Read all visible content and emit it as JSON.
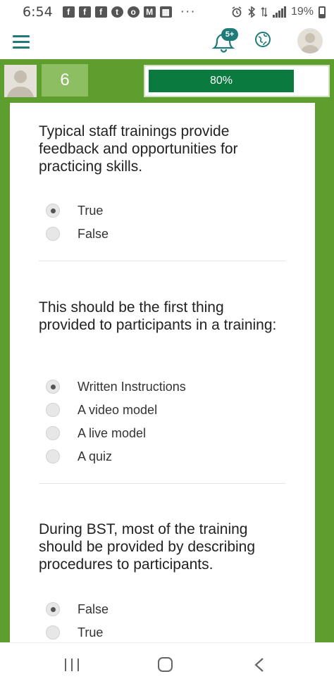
{
  "status_bar": {
    "time": "6:54",
    "app_icons": [
      "facebook-icon",
      "facebook-icon",
      "facebook-icon",
      "twitter-icon",
      "opera-icon",
      "gmail-icon",
      "photo-icon"
    ],
    "app_glyphs": [
      "f",
      "f",
      "f",
      "t",
      "o",
      "M",
      "▦"
    ],
    "more": "···",
    "battery_text": "19%",
    "right_icons": [
      "alarm-icon",
      "bluetooth-icon",
      "data-icon",
      "signal-icon",
      "battery-icon"
    ]
  },
  "header": {
    "notification_badge": "5+",
    "icons": [
      "menu-icon",
      "bell-icon",
      "globe-icon",
      "avatar"
    ]
  },
  "progress": {
    "level": "6",
    "percent_label": "80%",
    "percent_value": 80,
    "fill_color": "#0a7a3e",
    "band_color": "#5e9e2f"
  },
  "questions": [
    {
      "text": "Typical staff trainings provide feedback and opportunities for practicing skills.",
      "options": [
        {
          "label": "True",
          "selected": true
        },
        {
          "label": "False",
          "selected": false
        }
      ]
    },
    {
      "text": "This should be the first thing provided to participants in a training:",
      "options": [
        {
          "label": "Written Instructions",
          "selected": true
        },
        {
          "label": "A video model",
          "selected": false
        },
        {
          "label": "A live model",
          "selected": false
        },
        {
          "label": "A quiz",
          "selected": false
        }
      ]
    },
    {
      "text": "During BST, most of the training should be provided by describing procedures to participants.",
      "options": [
        {
          "label": "False",
          "selected": true
        },
        {
          "label": "True",
          "selected": false
        }
      ]
    }
  ],
  "nav": {
    "icons": [
      "recents-icon",
      "home-icon",
      "back-icon"
    ]
  }
}
